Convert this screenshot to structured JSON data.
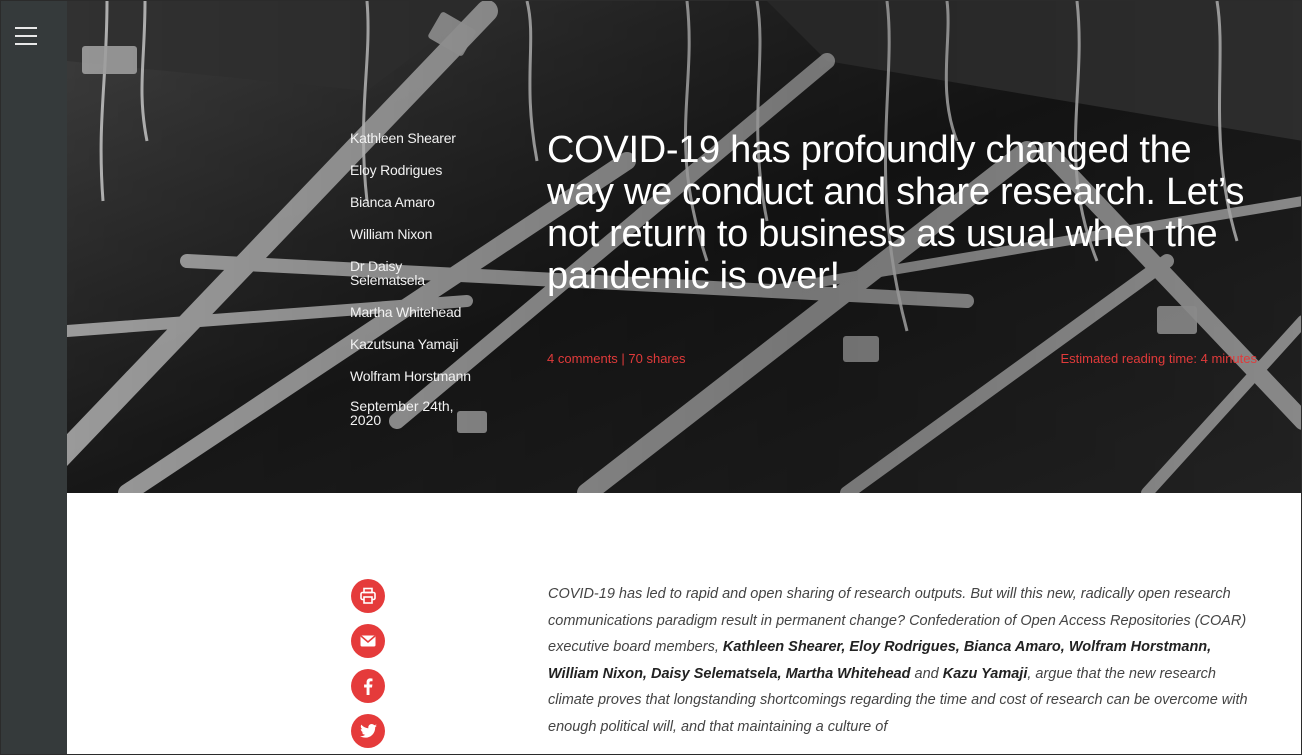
{
  "nav": {
    "menu_icon": "hamburger-icon"
  },
  "hero": {
    "authors": [
      "Kathleen Shearer",
      "Eloy Rodrigues",
      "Bianca Amaro",
      "William Nixon",
      "Dr Daisy Selematsela",
      "Martha Whitehead",
      "Kazutsuna Yamaji",
      "Wolfram Horstmann"
    ],
    "date": "September 24th, 2020",
    "title": "COVID-19 has profoundly changed the way we conduct and share research. Let’s not return to business as usual when the pandemic is over!",
    "comments_shares": "4 comments | 70 shares",
    "reading_time": "Estimated reading time: 4 minutes"
  },
  "share": {
    "icons": [
      "print-icon",
      "email-icon",
      "facebook-icon",
      "twitter-icon"
    ]
  },
  "article": {
    "intro_lead": "COVID-19 has led to rapid and open sharing of research outputs. But will this new, radically open research communications paradigm result in permanent change? Confederation of Open Access Repositories (COAR) executive board members, ",
    "intro_names": "Kathleen Shearer, Eloy Rodrigues, Bianca Amaro, Wolfram Horstmann, William Nixon, Daisy Selematsela, Martha Whitehead",
    "intro_and": " and ",
    "intro_last_name": "Kazu Yamaji",
    "intro_rest": ", argue that the new research climate proves that longstanding shortcomings regarding the time and cost of research can be overcome with enough political will, and that maintaining a culture of"
  },
  "colors": {
    "accent": "#e53b3b",
    "rail": "#353a3b"
  }
}
